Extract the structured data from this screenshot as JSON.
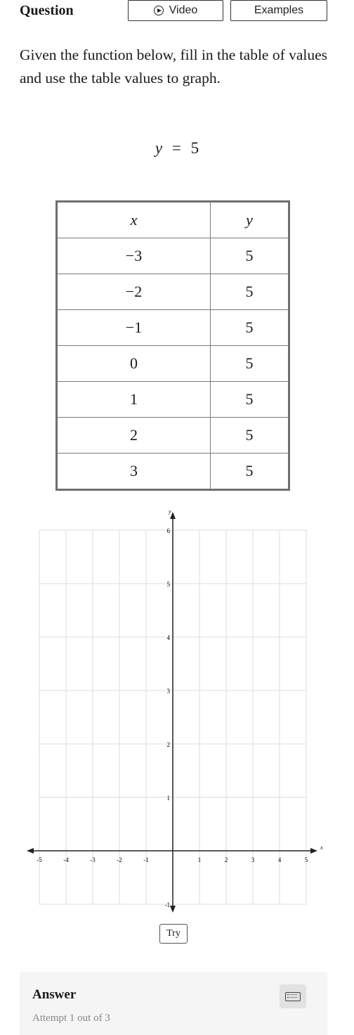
{
  "header": {
    "title": "Question",
    "video_label": "Video",
    "examples_label": "Examples"
  },
  "prompt": "Given the function below, fill in the table of values and use the table values to graph.",
  "equation": {
    "lhs": "y",
    "op": "=",
    "rhs": "5"
  },
  "table": {
    "headers": [
      "x",
      "y"
    ],
    "rows": [
      [
        "−3",
        "5"
      ],
      [
        "−2",
        "5"
      ],
      [
        "−1",
        "5"
      ],
      [
        "0",
        "5"
      ],
      [
        "1",
        "5"
      ],
      [
        "2",
        "5"
      ],
      [
        "3",
        "5"
      ]
    ]
  },
  "graph": {
    "x_axis_label": "x",
    "y_axis_label": "y",
    "x_ticks": [
      "-5",
      "-4",
      "-3",
      "-2",
      "-1",
      "1",
      "2",
      "3",
      "4",
      "5"
    ],
    "y_ticks": [
      "6",
      "5",
      "4",
      "3",
      "2",
      "1",
      "-1"
    ],
    "xlim": [
      -5,
      5
    ],
    "ylim": [
      -1,
      6
    ]
  },
  "try_label": "Try",
  "answer": {
    "label": "Answer",
    "attempt_text": "Attempt 1 out of 3"
  },
  "icons": {
    "video": "play-circle-icon",
    "keyboard": "keyboard-icon"
  }
}
